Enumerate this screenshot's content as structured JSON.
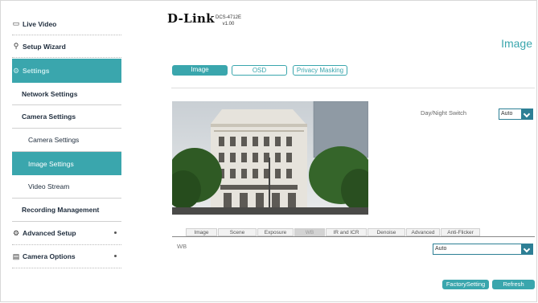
{
  "sidebar": {
    "live_video": "Live Video",
    "setup_wizard": "Setup Wizard",
    "settings": "Settings",
    "network_settings": "Network Settings",
    "camera_settings_group": "Camera Settings",
    "camera_settings": "Camera Settings",
    "image_settings": "Image Settings",
    "video_stream": "Video Stream",
    "recording_management": "Recording Management",
    "advanced_setup": "Advanced Setup",
    "camera_options": "Camera Options"
  },
  "header": {
    "logo": "D-Link",
    "model": "DCS-4712E",
    "version": "v1.00",
    "page_title": "Image"
  },
  "main_tabs": [
    "Image",
    "OSD",
    "Privacy Masking"
  ],
  "day_night": {
    "label": "Day/Night Switch",
    "value": "Auto"
  },
  "sub_tabs": [
    "Image",
    "Scene",
    "Exposure",
    "WB",
    "IR and ICR",
    "Denoise",
    "Advanced",
    "Anti-Flicker"
  ],
  "wb": {
    "label": "WB",
    "value": "Auto"
  },
  "buttons": {
    "factory": "FactorySetting",
    "refresh": "Refresh"
  },
  "colors": {
    "accent": "#3aa6ad",
    "select_arrow": "#2d7f95"
  }
}
